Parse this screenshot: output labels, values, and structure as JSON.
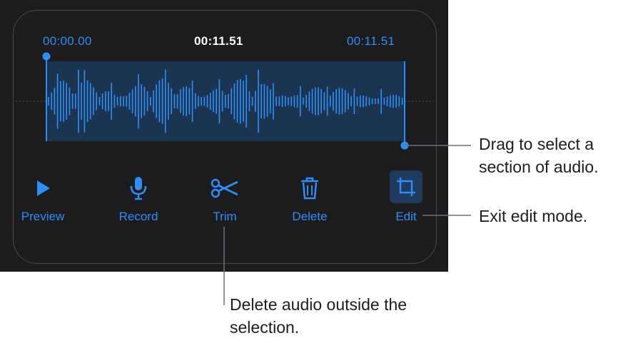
{
  "timeline": {
    "start_time": "00:00.00",
    "current_time": "00:11.51",
    "end_time": "00:11.51"
  },
  "toolbar": {
    "preview_label": "Preview",
    "record_label": "Record",
    "trim_label": "Trim",
    "delete_label": "Delete",
    "edit_label": "Edit"
  },
  "icons": {
    "preview": "play-icon",
    "record": "microphone-icon",
    "trim": "scissors-icon",
    "delete": "trash-icon",
    "edit": "crop-icon"
  },
  "callouts": {
    "selection_handles": "Drag to select a section of audio.",
    "edit_button": "Exit edit mode.",
    "trim_button": "Delete audio outside the selection."
  },
  "colors": {
    "accent": "#2f8ef5",
    "background": "#1c1c1e",
    "selection": "#1b3452",
    "text_primary": "#ffffff"
  }
}
